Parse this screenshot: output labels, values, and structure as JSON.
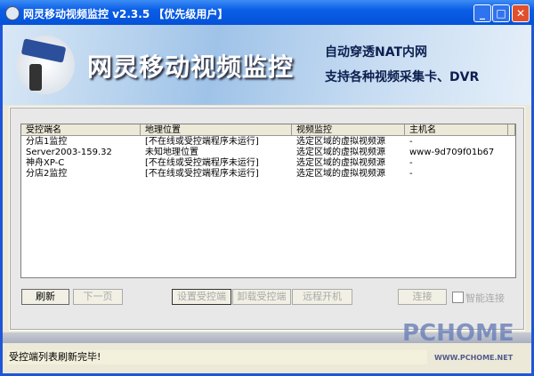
{
  "title": "网灵移动视频监控 v2.3.5  【优先级用户】",
  "banner": {
    "name": "网灵移动视频监控",
    "slogan1": "自动穿透NAT内网",
    "slogan2": "支持各种视频采集卡、DVR"
  },
  "list": {
    "columns": [
      "受控端名",
      "地理位置",
      "视频监控",
      "主机名"
    ],
    "rows": [
      [
        "分店1监控",
        "[不在线或受控端程序未运行]",
        "选定区域的虚拟视频源",
        "-"
      ],
      [
        "Server2003-159.32",
        "未知地理位置",
        "选定区域的虚拟视频源",
        "www-9d709f01b67"
      ],
      [
        "神舟XP-C",
        "[不在线或受控端程序未运行]",
        "选定区域的虚拟视频源",
        "-"
      ],
      [
        "分店2监控",
        "[不在线或受控端程序未运行]",
        "选定区域的虚拟视频源",
        "-"
      ]
    ]
  },
  "buttons": {
    "refresh": "刷新",
    "next": "下一页",
    "setup": "设置受控端",
    "uninstall": "卸载受控端",
    "wake": "远程开机",
    "connect": "连接",
    "smart": "智能连接"
  },
  "status": "受控端列表刷新完毕!",
  "watermark": {
    "main": "PCHOME",
    "sub": "WWW.PCHOME.NET"
  }
}
